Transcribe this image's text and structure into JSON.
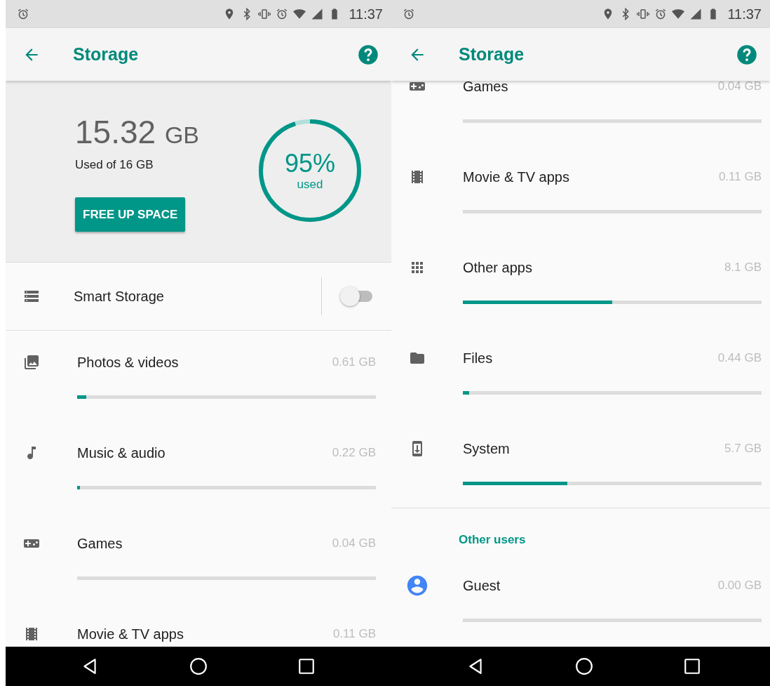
{
  "screens": [
    {
      "status_bar": {
        "time": "11:37"
      },
      "app_bar": {
        "title": "Storage"
      },
      "summary": {
        "used": "15.32",
        "unit": "GB",
        "caption": "Used of 16 GB",
        "button": "FREE UP SPACE",
        "percent": "95%",
        "percent_caption": "used",
        "level": 0.95
      },
      "smart_storage": {
        "label": "Smart Storage",
        "on": false
      },
      "items": [
        {
          "kind": "photos",
          "label": "Photos & videos",
          "size": "0.61 GB",
          "level": 0.03
        },
        {
          "kind": "music",
          "label": "Music & audio",
          "size": "0.22 GB",
          "level": 0.01
        },
        {
          "kind": "games",
          "label": "Games",
          "size": "0.04 GB"
        },
        {
          "kind": "movies",
          "label": "Movie & TV apps",
          "size": "0.11 GB"
        }
      ]
    },
    {
      "status_bar": {
        "time": "11:37"
      },
      "app_bar": {
        "title": "Storage"
      },
      "items": [
        {
          "kind": "games",
          "label": "Games",
          "size": "0.04 GB"
        },
        {
          "kind": "movies",
          "label": "Movie & TV apps",
          "size": "0.11 GB"
        },
        {
          "kind": "apps",
          "label": "Other apps",
          "size": "8.1 GB",
          "level": 0.5
        },
        {
          "kind": "files",
          "label": "Files",
          "size": "0.44 GB",
          "level": 0.02
        },
        {
          "kind": "system",
          "label": "System",
          "size": "5.7 GB",
          "level": 0.35
        },
        {
          "kind": "section",
          "label": "Other users"
        },
        {
          "kind": "user",
          "label": "Guest",
          "size": "0.00 GB"
        }
      ]
    }
  ]
}
